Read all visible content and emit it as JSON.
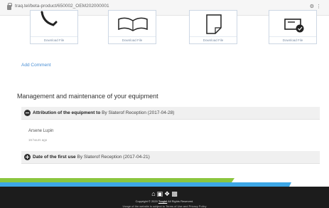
{
  "browser": {
    "url": "traq.tel/beta-product/650002_OEM202000001"
  },
  "files": [
    {
      "label": "Download File",
      "icon": "phone-icon"
    },
    {
      "label": "Download File",
      "icon": "open-book-icon"
    },
    {
      "label": "Download File",
      "icon": "document-icon"
    },
    {
      "label": "Download File",
      "icon": "checklist-icon"
    }
  ],
  "comments": {
    "add_label": "Add Comment"
  },
  "maintenance": {
    "title": "Management and maintenance of your equipment",
    "attribution": {
      "label": "Attribution of the equipment to",
      "detail": " By Slaterof Reception (2017-04-28)",
      "person": "Arsene Lupin",
      "time": "16 hours ago"
    },
    "first_use": {
      "label": "Date of the first use",
      "detail": " By Slaterof Reception (2017-04-21)"
    }
  },
  "footer": {
    "social_icons": [
      "home-icon",
      "facebook-icon",
      "twitter-icon",
      "linkedin-icon"
    ],
    "copyright_prefix": "Copyright © 2020 ",
    "copyright_brand": "Traqtel",
    "copyright_suffix": " All Rights Reserved.",
    "legal": "Usage of the website is subject to Terms of Use and Privacy Policy"
  },
  "colors": {
    "link": "#4a8fd4",
    "footer_bg": "#1c1c1c",
    "stripe_blue": "#3da7e6",
    "stripe_green": "#8bc63e"
  }
}
